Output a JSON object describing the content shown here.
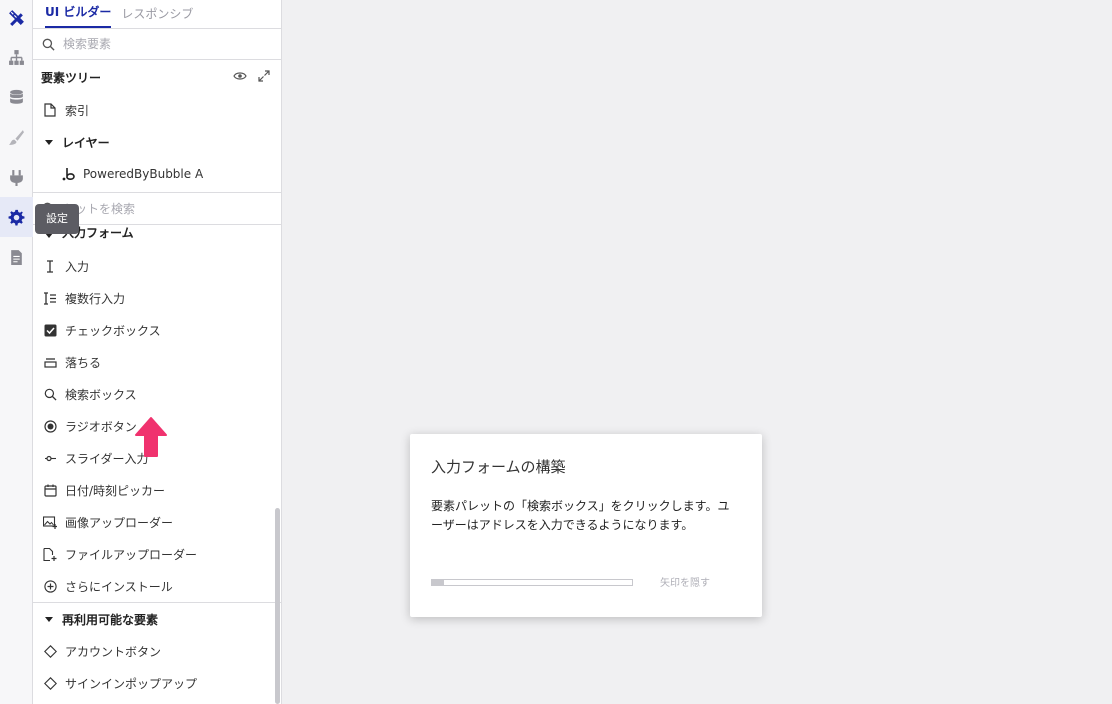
{
  "rail": {
    "icons": [
      "design-icon",
      "structure-icon",
      "data-icon",
      "styles-icon",
      "plugins-icon",
      "settings-icon",
      "logs-icon"
    ],
    "active_color": "#1b2aa5"
  },
  "tabs": {
    "ui_builder": "UI ビルダー",
    "responsive": "レスポンシブ"
  },
  "search": {
    "placeholder": "検索要素"
  },
  "tree": {
    "title": "要素ツリー",
    "index": "索引",
    "layers": "レイヤー",
    "powered": "PoweredByBubble A"
  },
  "asset_search": {
    "placeholder": "セットを検索"
  },
  "tooltip": "設定",
  "input_forms": {
    "title": "入力フォーム",
    "items": [
      "入力",
      "複数行入力",
      "チェックボックス",
      "落ちる",
      "検索ボックス",
      "ラジオボタン",
      "スライダー入力",
      "日付/時刻ピッカー",
      "画像アップローダー",
      "ファイルアップローダー",
      "さらにインストール"
    ]
  },
  "reusable": {
    "title": "再利用可能な要素",
    "items": [
      "アカウントボタン",
      "サインインポップアップ"
    ]
  },
  "tour": {
    "title": "入力フォームの構築",
    "body": "要素パレットの「検索ボックス」をクリックします。ユーザーはアドレスを入力できるようになります。",
    "progress": 0.06,
    "hide_label": "矢印を隠す"
  },
  "colors": {
    "accent": "#1b2aa5",
    "arrow": "#f0326e"
  }
}
